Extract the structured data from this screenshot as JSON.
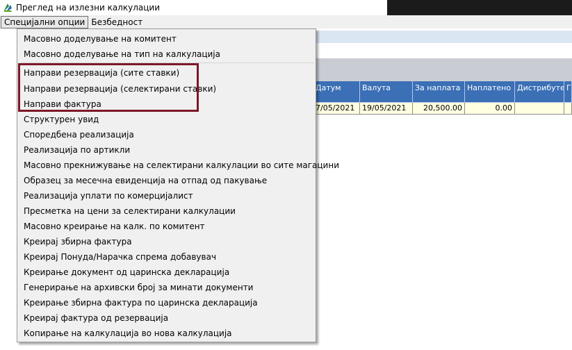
{
  "window": {
    "title": "Преглед на излезни калкулации",
    "icon": "app-logo-icon"
  },
  "menubar": {
    "items": [
      "Специјални опции",
      "Безбедност"
    ]
  },
  "grid": {
    "columns": [
      "Датум",
      "Валута",
      "За наплата",
      "Наплатено",
      "Дистрибутер",
      "Гр"
    ],
    "row": [
      "7/05/2021",
      "19/05/2021",
      "20,500.00",
      "0.00",
      "",
      ""
    ]
  },
  "dropdown": {
    "items": [
      "Масовно доделување на комитент",
      "Масовно доделување  на тип на калкулација",
      "Направи резервација (сите ставки)",
      "Направи резервација (селектирани ставки)",
      "Направи фактура",
      "Структурен увид",
      "Споредбена реализација",
      "Реализација по артикли",
      "Масовно прекнижување на селектирани калкулации во сите магацини",
      "Образец за месечна евиденција на отпад од пакување",
      "Реализација уплати по комерцијалист",
      "Пресметка на цени за селектирани калкулации",
      "Масовно креирање на калк. по комитент",
      "Креирај збирна фактура",
      "Креирај Понуда/Нарачка спрема добавувач",
      "Креирање документ од царинска декларација",
      "Генерирање на архивски број за минати документи",
      "Креирање збирна фактура по царинска декларација",
      "Креирај фактура од резервација",
      "Копирање на калкулација во нова калкулација"
    ]
  },
  "colors": {
    "highlight": "#7d1728",
    "grid_header": "#3b6fb6",
    "grid_row": "#ffffe1"
  }
}
